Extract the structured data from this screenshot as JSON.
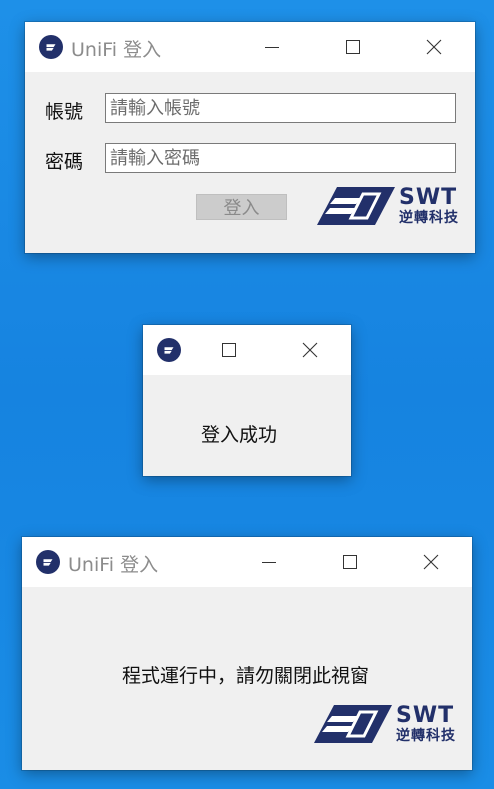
{
  "login_window": {
    "title": "UniFi 登入",
    "account_label": "帳號",
    "account_placeholder": "請輸入帳號",
    "password_label": "密碼",
    "password_placeholder": "請輸入密碼",
    "login_button": "登入",
    "logo_brand": "SWT",
    "logo_cn": "逆轉科技"
  },
  "success_dialog": {
    "message": "登入成功"
  },
  "running_window": {
    "title": "UniFi 登入",
    "message": "程式運行中，請勿關閉此視窗",
    "logo_brand": "SWT",
    "logo_cn": "逆轉科技"
  },
  "colors": {
    "desktop": "#1683e0",
    "brand_navy": "#22306a",
    "window_body": "#f0f0f0"
  },
  "icons": [
    "app-logo-icon",
    "minimize-icon",
    "maximize-icon",
    "close-icon",
    "swt-logo-mark"
  ]
}
